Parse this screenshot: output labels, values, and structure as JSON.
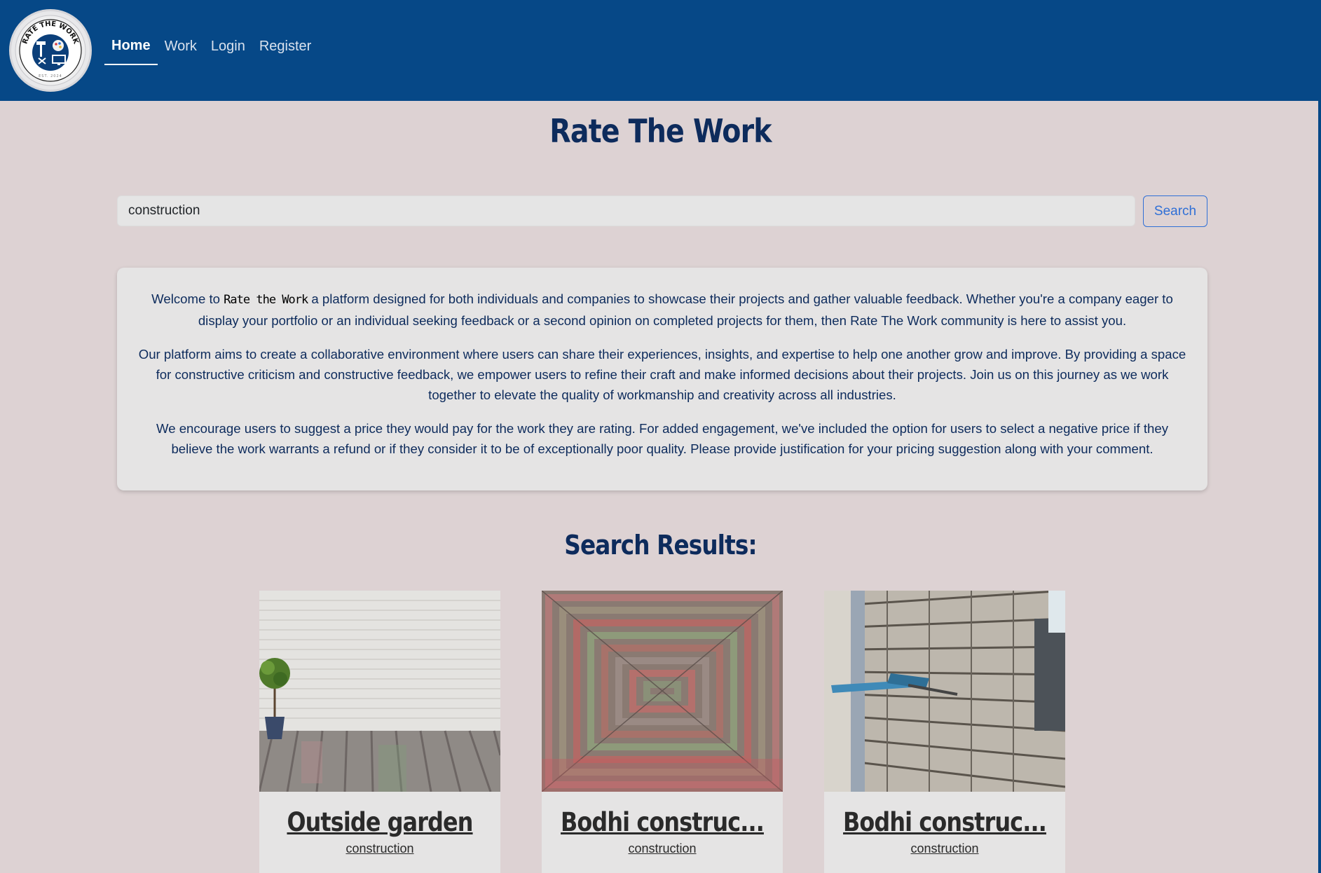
{
  "nav": {
    "logo_text": "RATE THE WORK",
    "logo_est": "EST. 2024",
    "links": [
      {
        "label": "Home",
        "active": true
      },
      {
        "label": "Work",
        "active": false
      },
      {
        "label": "Login",
        "active": false
      },
      {
        "label": "Register",
        "active": false
      }
    ]
  },
  "page_title": "Rate The Work",
  "search": {
    "value": "construction",
    "button_label": "Search"
  },
  "welcome": {
    "p1_start": "Welcome to ",
    "p1_brand": "Rate the Work",
    "p1_rest": " a platform designed for both individuals and companies to showcase their projects and gather valuable feedback. Whether you're a company eager to display your portfolio or an individual seeking feedback or a second opinion on completed projects for them, then Rate The Work community is here to assist you.",
    "p2": "Our platform aims to create a collaborative environment where users can share their experiences, insights, and expertise to help one another grow and improve. By providing a space for constructive criticism and constructive feedback, we empower users to refine their craft and make informed decisions about their projects. Join us on this journey as we work together to elevate the quality of workmanship and creativity across all industries.",
    "p3": "We encourage users to suggest a price they would pay for the work they are rating. For added engagement, we've included the option for users to select a negative price if they believe the work warrants a refund or if they consider it to be of exceptionally poor quality. Please provide justification for your pricing suggestion along with your comment."
  },
  "results": {
    "heading": "Search Results:",
    "items": [
      {
        "title": "Outside garden",
        "category": "construction",
        "image": "white-brick-wall-wood-floor-plant"
      },
      {
        "title": "Bodhi construc...",
        "category": "construction",
        "image": "herringbone-brick-paving"
      },
      {
        "title": "Bodhi construc...",
        "category": "construction",
        "image": "brick-wall-with-clamp"
      }
    ]
  },
  "colors": {
    "navbar": "#064887",
    "background": "#ddd2d3",
    "heading": "#0d2b5c",
    "search_button": "#2f6fd6"
  }
}
